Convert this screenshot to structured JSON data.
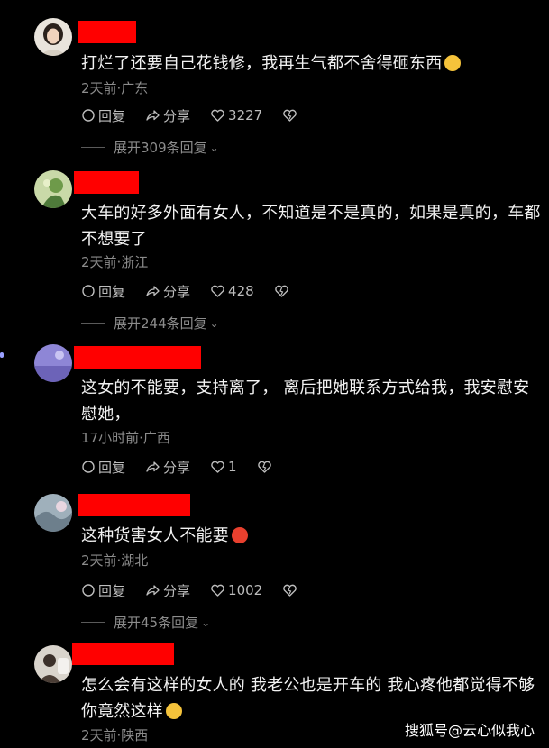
{
  "comments": [
    {
      "text": "打烂了还要自己花钱修，我再生气都不舍得砸东西",
      "emoji": "laugh-cry-emoji",
      "meta": "2天前·广东",
      "reply": "回复",
      "share": "分享",
      "likes": "3227",
      "expand": "展开309条回复"
    },
    {
      "text": "大车的好多外面有女人，不知道是不是真的，如果是真的，车都不想要了",
      "meta": "2天前·浙江",
      "reply": "回复",
      "share": "分享",
      "likes": "428",
      "expand": "展开244条回复"
    },
    {
      "text": "这女的不能要，支持离了， 离后把她联系方式给我，我安慰安慰她，",
      "meta": "17小时前·广西",
      "reply": "回复",
      "share": "分享",
      "likes": "1"
    },
    {
      "text": "这种货害女人不能要",
      "emoji": "angry-emoji",
      "meta": "2天前·湖北",
      "reply": "回复",
      "share": "分享",
      "likes": "1002",
      "expand": "展开45条回复"
    },
    {
      "text": "怎么会有这样的女人的 我老公也是开车的 我心疼他都觉得不够你竟然这样",
      "emoji": "thinking-emoji",
      "meta": "2天前·陕西"
    }
  ],
  "watermark": "搜狐号@云心似我心",
  "colors": {
    "redaction": "#ff0000",
    "background": "#000000",
    "meta": "#8c8c8c"
  }
}
